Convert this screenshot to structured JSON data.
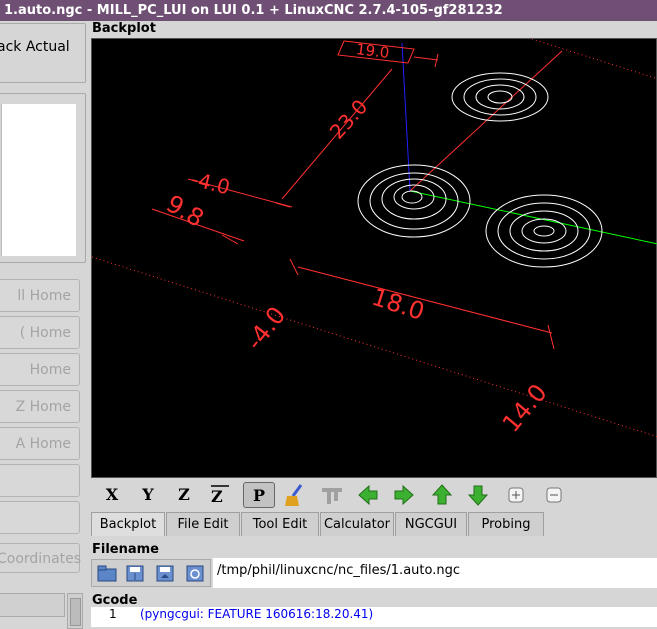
{
  "window": {
    "title": "1.auto.ngc - MILL_PC_LUI on LUI 0.1 + LinuxCNC 2.7.4-105-gf281232"
  },
  "left_panel": {
    "actual_label": "ack Actual",
    "home_buttons": [
      "ll Home",
      "( Home",
      "Home",
      "Z Home",
      "A Home",
      "",
      ""
    ],
    "coordinates_button": "Coordinates"
  },
  "backplot": {
    "section_label": "Backplot",
    "dimensions": [
      "19.0",
      "23.0",
      "-4.0",
      "18.0",
      "-4.0",
      "14.0",
      "9.8"
    ]
  },
  "toolbar": {
    "view_buttons": [
      "X",
      "Y",
      "Z",
      "Z2",
      "P"
    ],
    "icons": [
      "clear-plot-icon",
      "tool-icon",
      "left-arrow-icon",
      "right-arrow-icon",
      "up-arrow-icon",
      "down-arrow-icon",
      "zoom-in-icon",
      "zoom-out-icon"
    ]
  },
  "tabs": [
    "Backplot",
    "File Edit",
    "Tool Edit",
    "Calculator",
    "NGCGUI",
    "Probing"
  ],
  "filename": {
    "section_label": "Filename",
    "value": "/tmp/phil/linuxcnc/nc_files/1.auto.ngc"
  },
  "gcode": {
    "section_label": "Gcode",
    "line_number": "1",
    "line_text": "(pyngcgui: FEATURE 160616:18.20.41)"
  },
  "colors": {
    "title_bg": "#6f4f74",
    "plot_bg": "#000000",
    "dim_red": "#ff3030",
    "x_axis": "#ff3030",
    "y_axis": "#00ff00",
    "z_axis": "#2020ff"
  }
}
